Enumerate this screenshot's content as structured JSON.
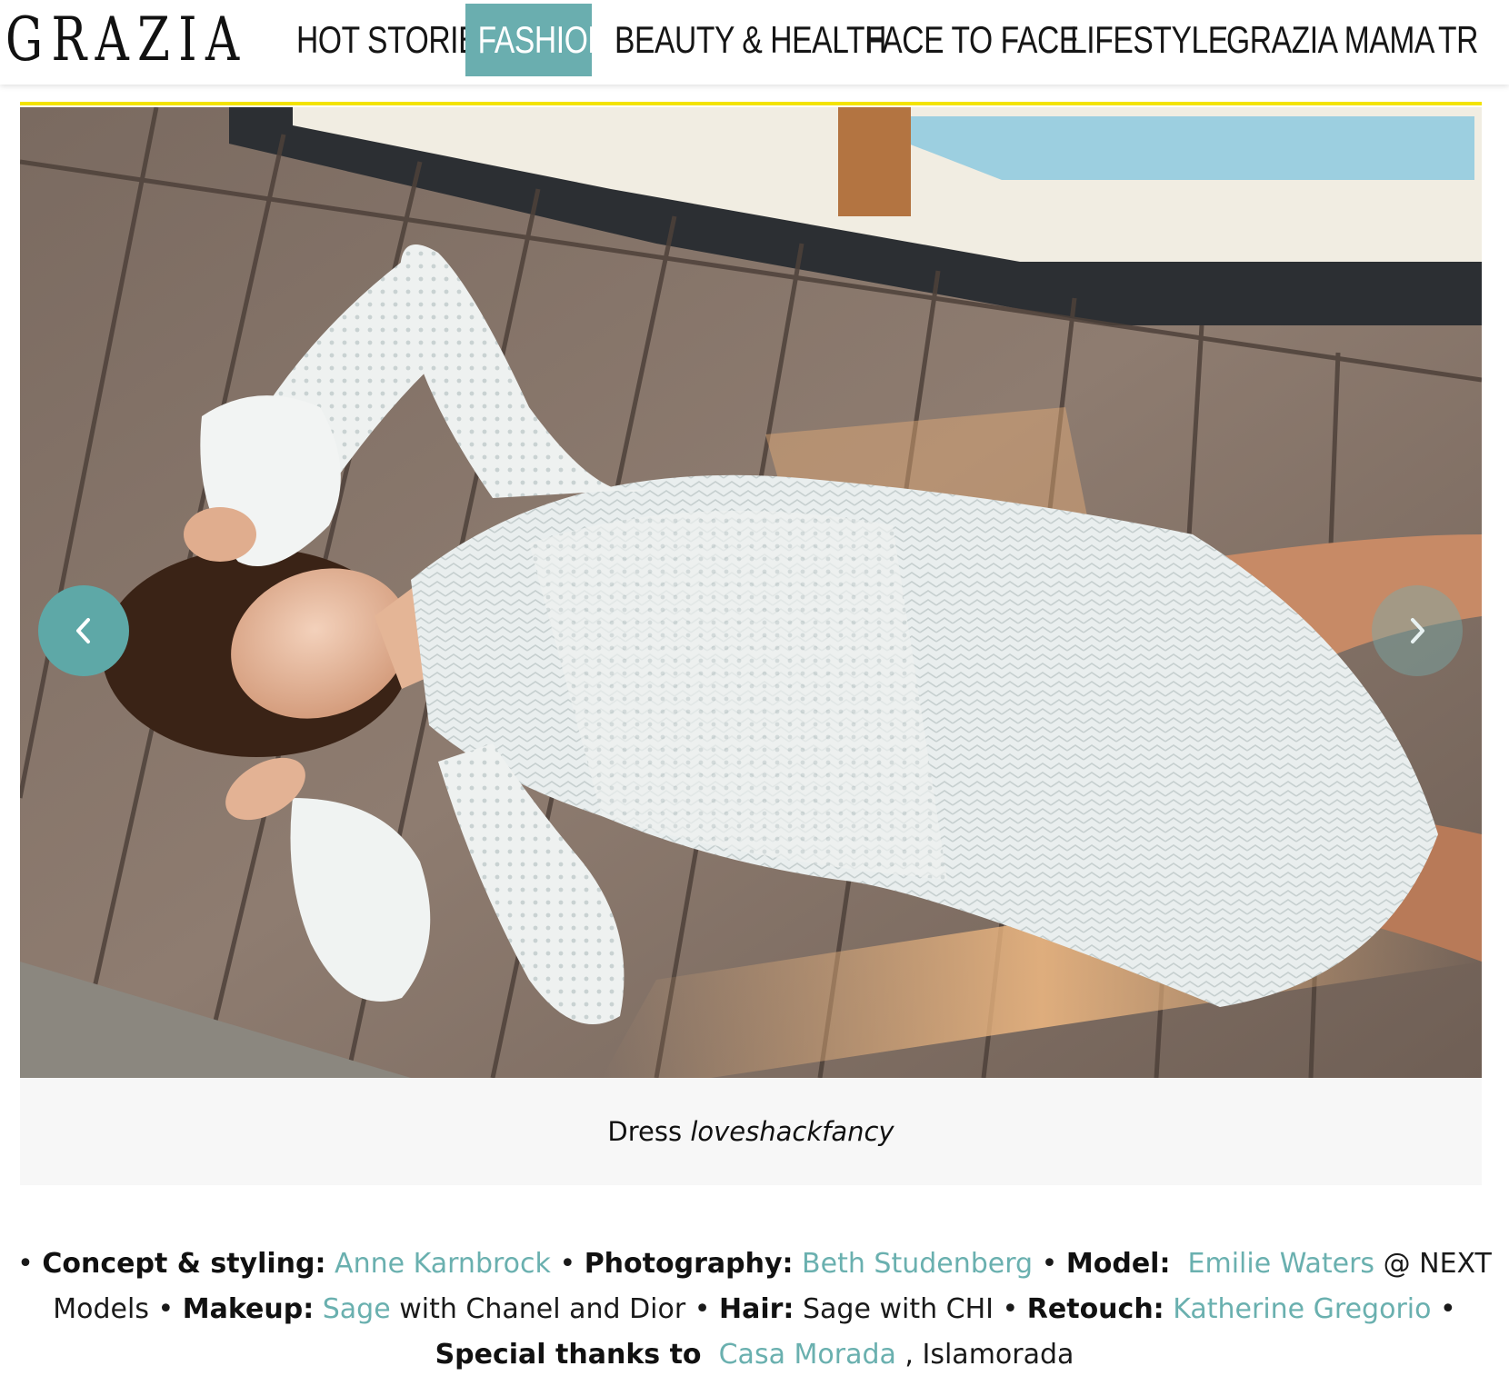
{
  "header": {
    "logo": "GRAZIA",
    "nav": [
      {
        "label": "HOT STORIES",
        "active": false
      },
      {
        "label": "FASHION",
        "active": true
      },
      {
        "label": "BEAUTY & HEALTH",
        "active": false
      },
      {
        "label": "FACE TO FACE",
        "active": false
      },
      {
        "label": "LIFESTYLE",
        "active": false
      },
      {
        "label": "GRAZIA MAMA",
        "active": false
      },
      {
        "label": "TR",
        "active": false
      }
    ],
    "active_color": "#6aaeaf"
  },
  "gallery": {
    "prev_icon": "chevron-left-icon",
    "next_icon": "chevron-right-icon",
    "caption_prefix": "Dress",
    "caption_brand": "loveshackfancy"
  },
  "credits": {
    "bullet": "•",
    "concept_label": "Concept & styling:",
    "concept_name": "Anne Karnbrock",
    "photo_label": "Photography:",
    "photo_name": "Beth Studenberg",
    "model_label": "Model:",
    "model_name": "Emilie Waters",
    "model_agency": "@ NEXT Models",
    "makeup_label": "Makeup:",
    "makeup_name": "Sage",
    "makeup_rest": "with Chanel and Dior",
    "hair_label": "Hair:",
    "hair_text": "Sage with CHI",
    "retouch_label": "Retouch:",
    "retouch_name": "Katherine Gregorio",
    "thanks_label": "Special thanks to",
    "thanks_name": "Casa Morada",
    "thanks_place": ", Islamorada"
  }
}
